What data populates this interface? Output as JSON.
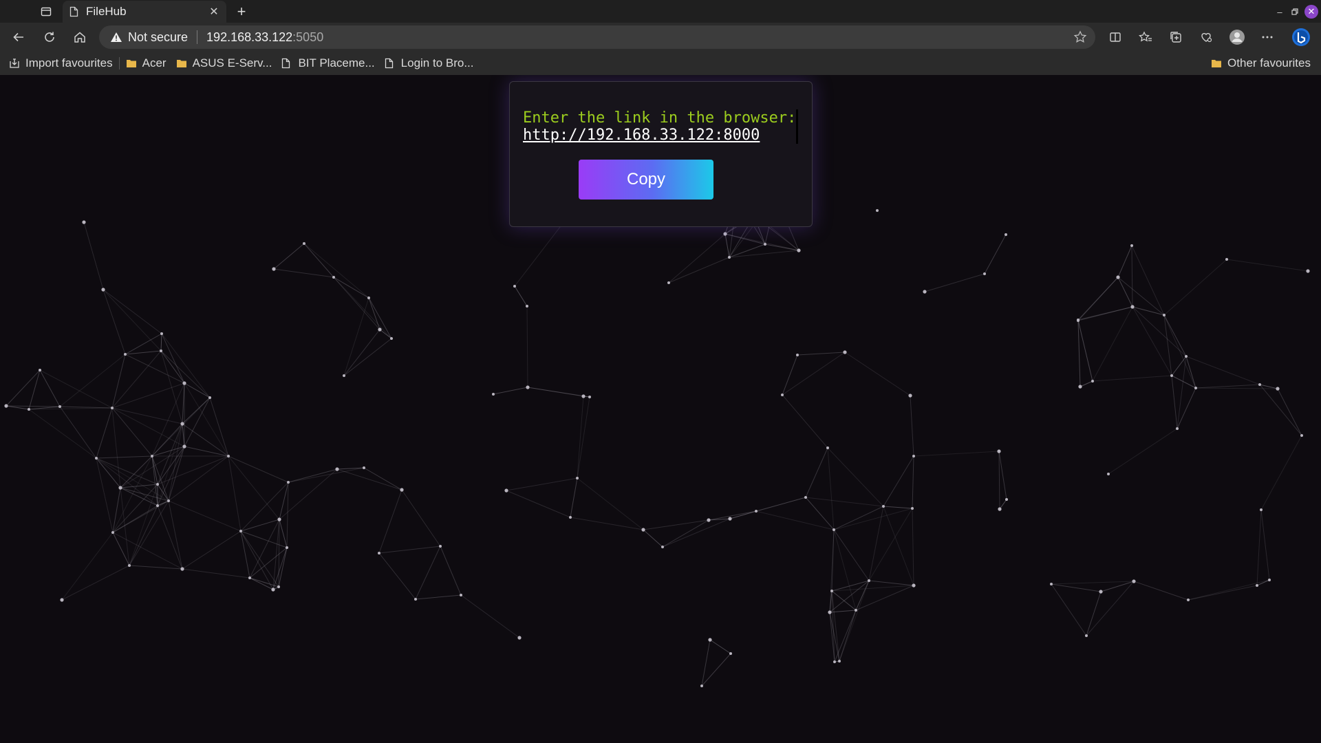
{
  "browser": {
    "tab": {
      "title": "FileHub",
      "icon": "page-icon",
      "close_icon": "close-icon"
    },
    "new_tab_icon": "plus-icon",
    "window_controls": [
      "minimize-icon",
      "restore-icon",
      "close-icon"
    ],
    "toolbar": {
      "security_label": "Not secure",
      "url_host": "192.168.33.122",
      "url_port": ":5050",
      "nav_icons": [
        "back-icon",
        "refresh-icon",
        "home-icon"
      ],
      "right_icons": [
        "split-screen-icon",
        "favourites-icon",
        "collections-icon",
        "extensions-icon",
        "profile-icon",
        "more-icon",
        "bing-icon"
      ]
    },
    "bookmarks": [
      {
        "label": "Import favourites",
        "icon": "import-icon"
      },
      {
        "label": "Acer",
        "icon": "folder-icon"
      },
      {
        "label": "ASUS E-Serv...",
        "icon": "folder-icon"
      },
      {
        "label": "BIT Placeme...",
        "icon": "page-icon"
      },
      {
        "label": "Login to Bro...",
        "icon": "page-icon"
      }
    ],
    "other_favourites": {
      "label": "Other favourites",
      "icon": "folder-icon"
    }
  },
  "page": {
    "prompt": "Enter the link in the browser:",
    "link": "http://192.168.33.122:8000",
    "copy_label": "Copy"
  },
  "colors": {
    "background": "#0e0b10",
    "prompt_text": "#9ccd1e",
    "button_gradient_start": "#9a3cf6",
    "button_gradient_end": "#1cc9e8",
    "accent": "#8b46c9"
  }
}
